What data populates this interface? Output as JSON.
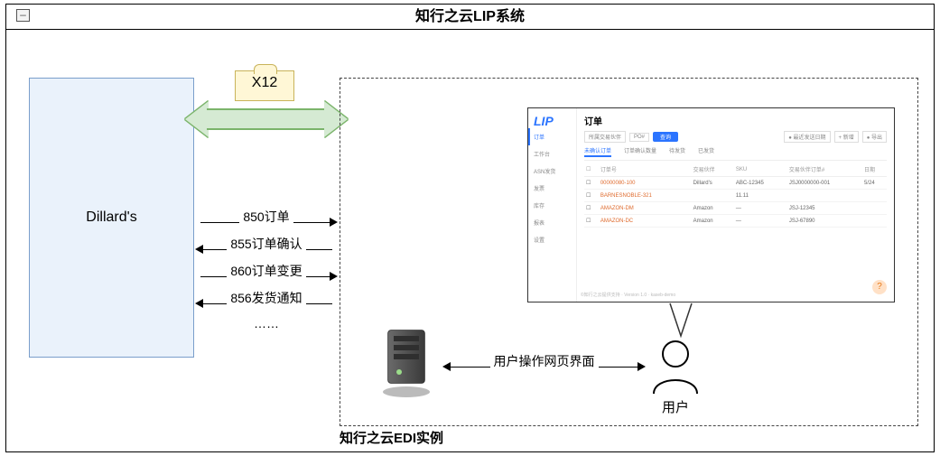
{
  "title": "知行之云LIP系统",
  "partner": "Dillard's",
  "x12_label": "X12",
  "flows": [
    {
      "label": "850订单",
      "dir": "right"
    },
    {
      "label": "855订单确认",
      "dir": "left"
    },
    {
      "label": "860订单变更",
      "dir": "right"
    },
    {
      "label": "856发货通知",
      "dir": "left"
    }
  ],
  "flow_ellipsis": "……",
  "edi_instance_label": "知行之云EDI实例",
  "user_label": "用户",
  "srv_user_label": "用户操作网页界面",
  "app": {
    "logo": "LIP",
    "page_title": "订单",
    "nav": [
      "订单",
      "工作台",
      "ASN发货",
      "发票",
      "库存",
      "报表",
      "设置"
    ],
    "nav_active_index": 0,
    "toolbar": {
      "dropdown": "所属交易伙伴",
      "search_placeholder": "PO#",
      "search_btn": "查询",
      "date_chip": "● 最近发送日期",
      "add_chip": "+ 新增",
      "export_chip": "● 导出"
    },
    "tabs": [
      "未确认订单",
      "订单确认数量",
      "待发货",
      "已发货"
    ],
    "tab_active_index": 0,
    "columns": [
      "订单号",
      "交易伙伴",
      "SKU",
      "交易伙伴订单#",
      "日期"
    ],
    "rows": [
      [
        "00000080-100",
        "Dillard's",
        "ABC-12345",
        "JSJ0000000-001",
        "5/24"
      ],
      [
        "BARNESNOBLE-321",
        "",
        "11.11",
        "",
        ""
      ],
      [
        "AMAZON-DM",
        "Amazon",
        "—",
        "JSJ-12345",
        ""
      ],
      [
        "AMAZON-DC",
        "Amazon",
        "—",
        "JSJ-67890",
        ""
      ]
    ],
    "footer_note": "©知行之云提供支持 · Version 1.0 · kaseb-demo"
  }
}
